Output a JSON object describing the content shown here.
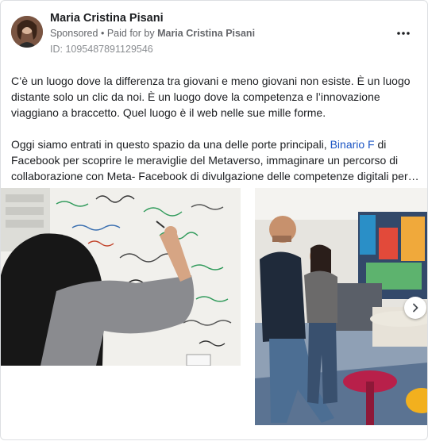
{
  "post": {
    "author_name": "Maria Cristina Pisani",
    "sponsored_label": "Sponsored",
    "separator": "•",
    "paid_for_prefix": "Paid for by",
    "paid_for_name": "Maria Cristina Pisani",
    "ad_id": "ID: 1095487891129546",
    "more_icon": "more-dots-icon",
    "paragraph1": "C’è un luogo dove la differenza tra giovani e meno giovani non esiste. È un luogo distante solo un clic da noi. È un luogo dove la competenza e l’innovazione viaggiano a braccetto. Quel luogo è il web nelle sue mille forme.",
    "paragraph2_before_link": "Oggi siamo entrati in questo spazio da una delle porte principali, ",
    "paragraph2_link": "Binario F",
    "paragraph2_after_link": " di Facebook per scoprire le meraviglie del Metaverso, immaginare un percorso di ",
    "paragraph2_last_line": "collaborazione con Meta- Facebook di divulgazione delle competenze digitali per…"
  },
  "carousel": {
    "next_icon": "chevron-right-icon"
  },
  "colors": {
    "link": "#1a54c4",
    "secondary_text": "#65676b"
  }
}
